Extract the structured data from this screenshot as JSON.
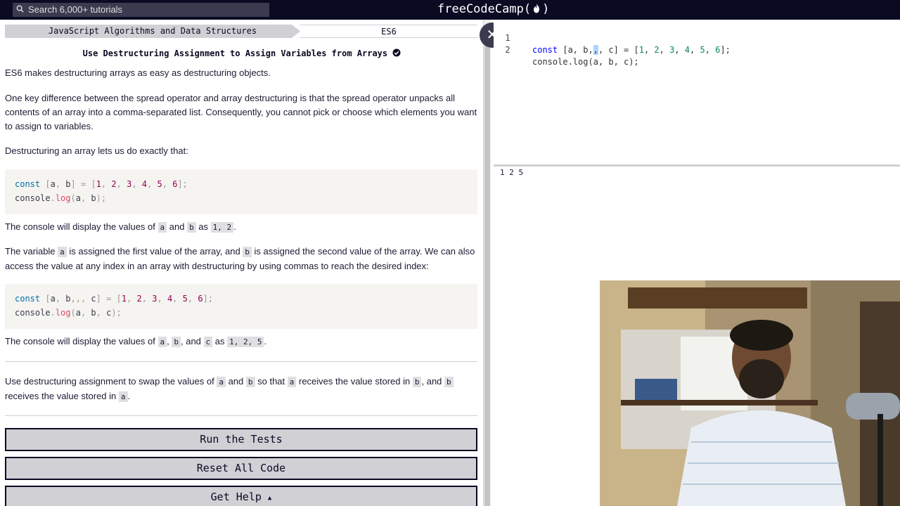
{
  "nav": {
    "search_placeholder": "Search 6,000+ tutorials",
    "brand": "freeCodeCamp"
  },
  "breadcrumb": {
    "superblock": "JavaScript Algorithms and Data Structures",
    "block": "ES6"
  },
  "challenge": {
    "title": "Use Destructuring Assignment to Assign Variables from Arrays",
    "p1": "ES6 makes destructuring arrays as easy as destructuring objects.",
    "p2": "One key difference between the spread operator and array destructuring is that the spread operator unpacks all contents of an array into a comma-separated list. Consequently, you cannot pick or choose which elements you want to assign to variables.",
    "p3": "Destructuring an array lets us do exactly that:",
    "p4": {
      "a": "The console will display the values of ",
      "b": " and ",
      "c": " as ",
      "d": "."
    },
    "p5": {
      "a": "The variable ",
      "b": " is assigned the first value of the array, and ",
      "c": " is assigned the second value of the array. We can also access the value at any index in an array with destructuring by using commas to reach the desired index:"
    },
    "p6": {
      "a": "The console will display the values of ",
      "b": ", ",
      "c": ", and ",
      "d": " as ",
      "e": "."
    },
    "p7": {
      "a": "Use destructuring assignment to swap the values of ",
      "b": " and ",
      "c": " so that ",
      "d": " receives the value stored in ",
      "e": ", and ",
      "f": " receives the value stored in ",
      "g": "."
    },
    "inline": {
      "a": "a",
      "b": "b",
      "c": "c",
      "ab_values": "1, 2",
      "abc_values": "1, 2, 5"
    }
  },
  "buttons": {
    "run": "Run the Tests",
    "reset": "Reset All Code",
    "help": "Get Help"
  },
  "editor": {
    "lines": [
      {
        "num": "1",
        "text": "const [a, b,,, c] = [1, 2, 3, 4, 5, 6];"
      },
      {
        "num": "2",
        "text": "console.log(a, b, c);"
      }
    ]
  },
  "console_output": "1 2 5",
  "colors": {
    "nav_bg": "#0a0a23",
    "button_bg": "#d0d0d5",
    "code_bg": "#f5f4f0"
  }
}
